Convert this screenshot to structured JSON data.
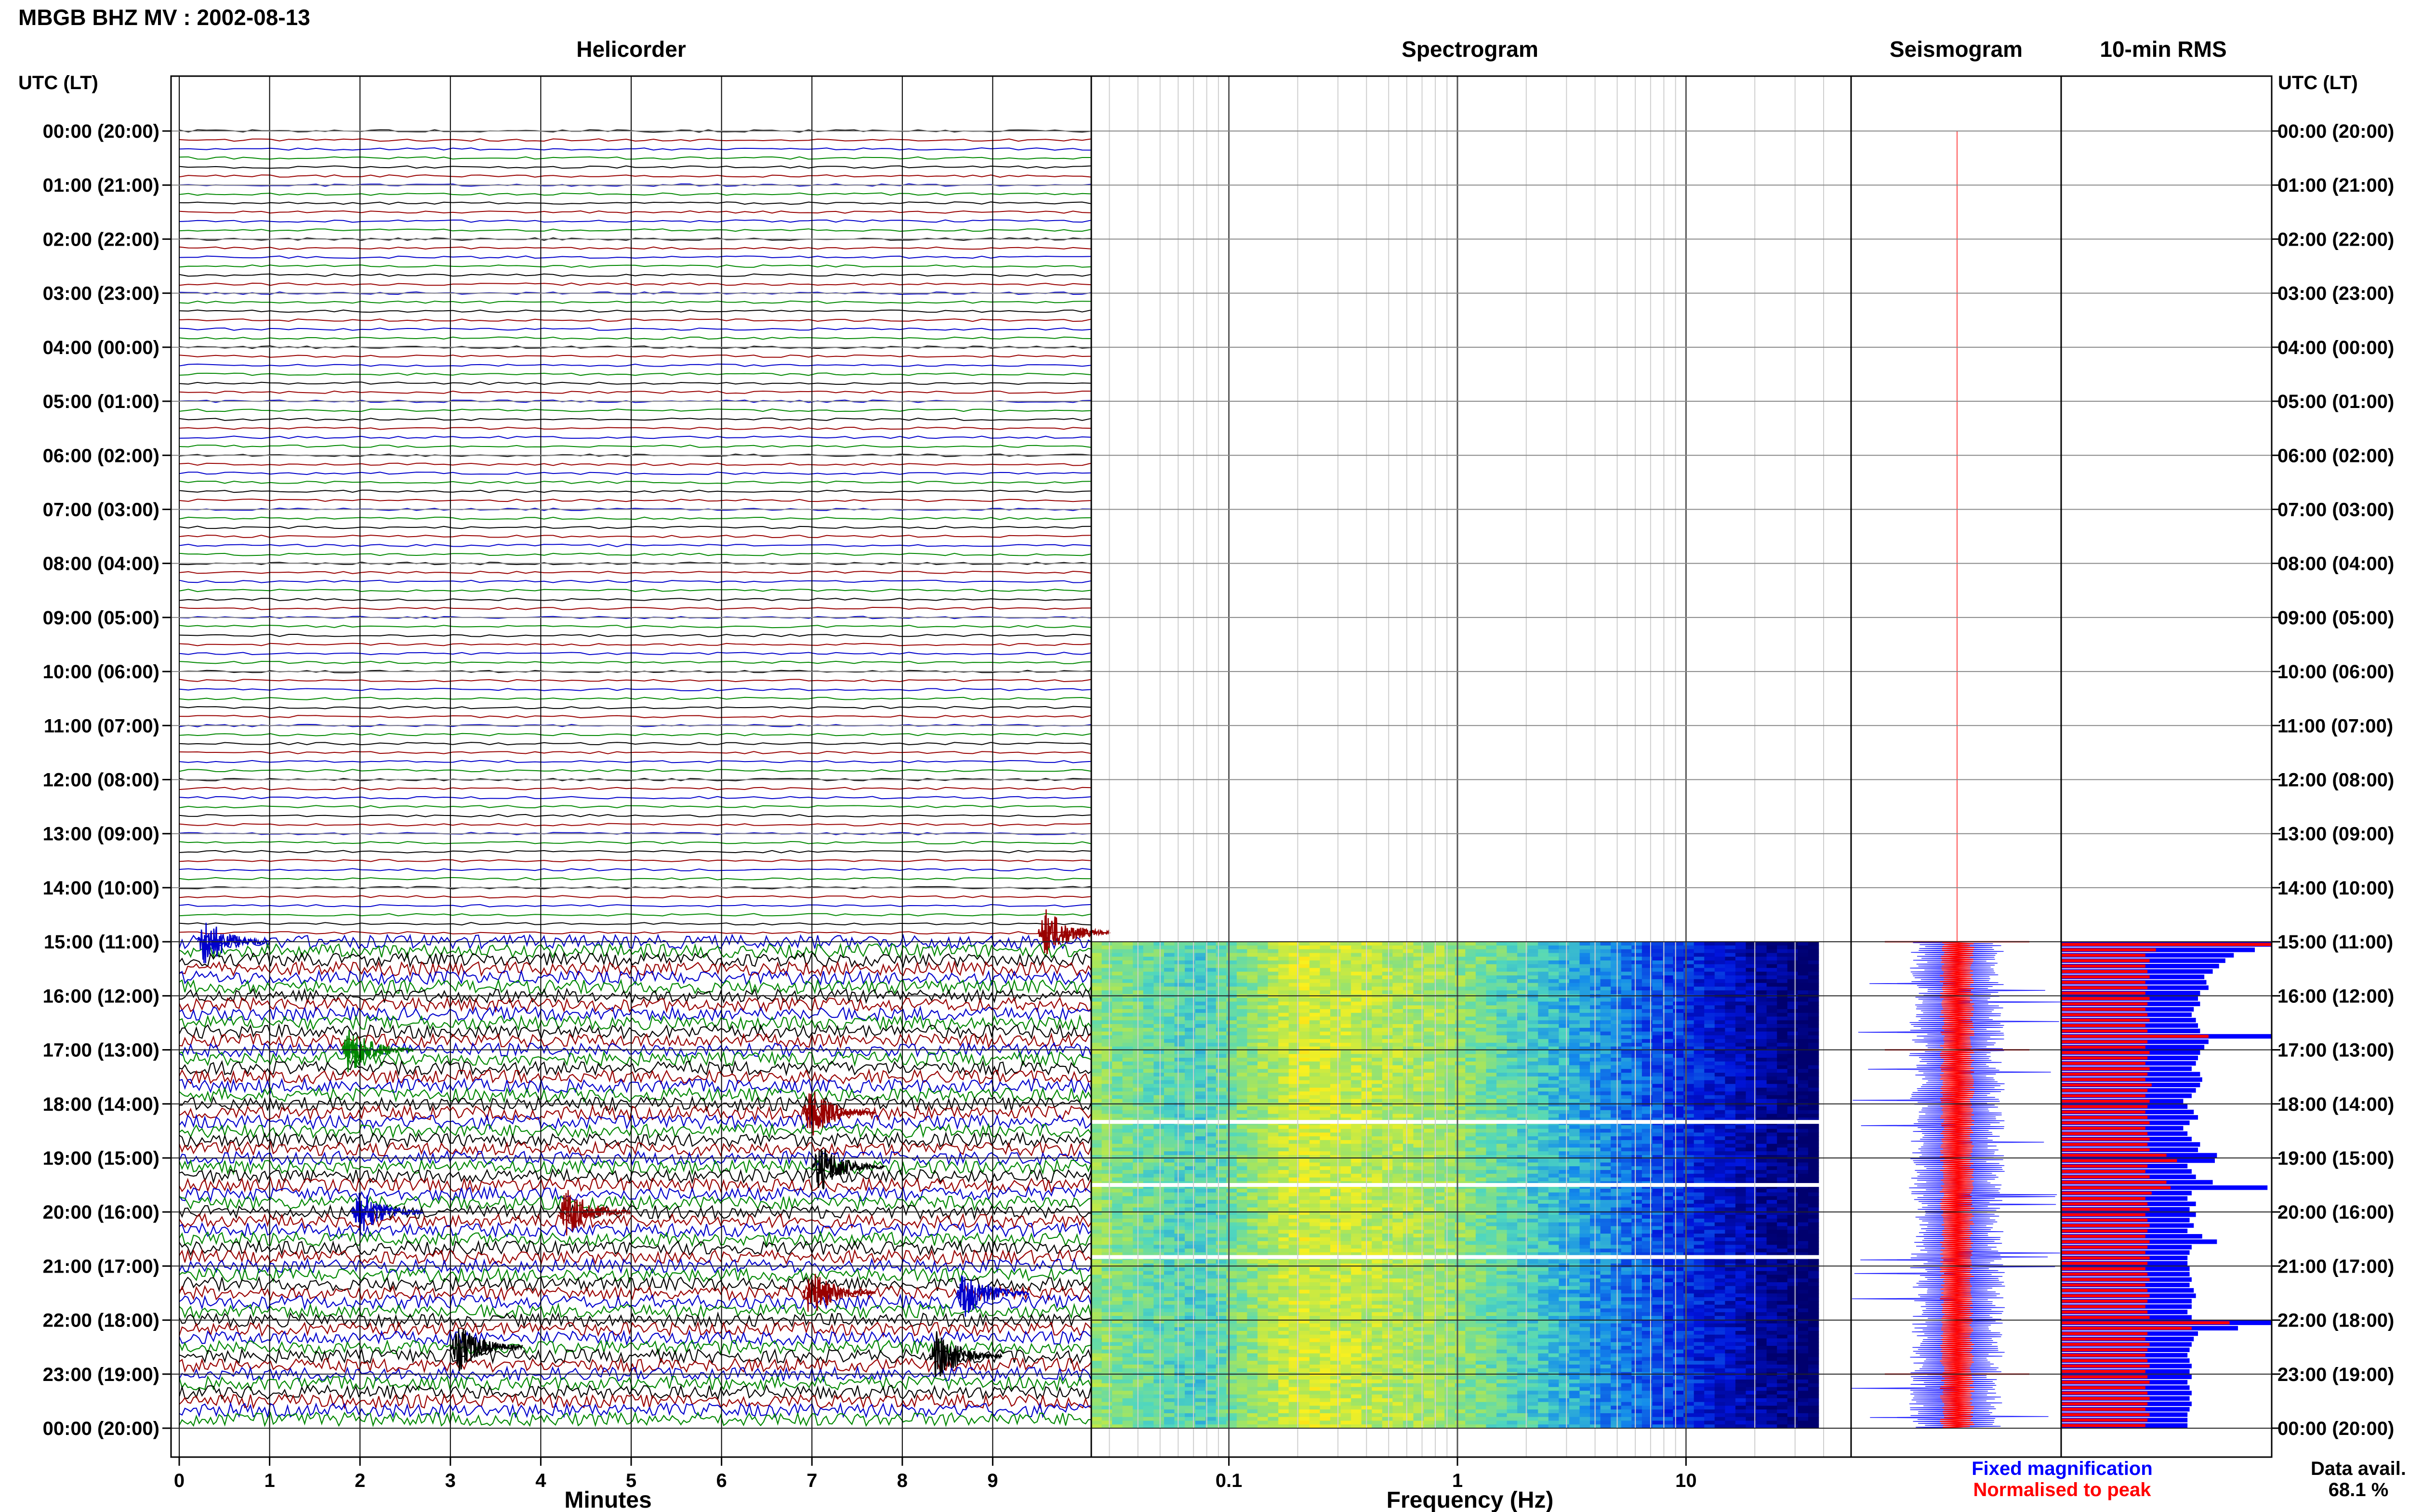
{
  "title": "MBGB BHZ MV : 2002-08-13",
  "panels": {
    "helicorder": "Helicorder",
    "spectrogram": "Spectrogram",
    "seismogram": "Seismogram",
    "rms": "10-min RMS"
  },
  "time_axis_label": "UTC (LT)",
  "time_ticks": [
    "00:00 (20:00)",
    "01:00 (21:00)",
    "02:00 (22:00)",
    "03:00 (23:00)",
    "04:00 (00:00)",
    "05:00 (01:00)",
    "06:00 (02:00)",
    "07:00 (03:00)",
    "08:00 (04:00)",
    "09:00 (05:00)",
    "10:00 (06:00)",
    "11:00 (07:00)",
    "12:00 (08:00)",
    "13:00 (09:00)",
    "14:00 (10:00)",
    "15:00 (11:00)",
    "16:00 (12:00)",
    "17:00 (13:00)",
    "18:00 (14:00)",
    "19:00 (15:00)",
    "20:00 (16:00)",
    "21:00 (17:00)",
    "22:00 (18:00)",
    "23:00 (19:00)",
    "00:00 (20:00)"
  ],
  "minutes_ticks": [
    "0",
    "1",
    "2",
    "3",
    "4",
    "5",
    "6",
    "7",
    "8",
    "9"
  ],
  "minutes_label": "Minutes",
  "freq_ticks": [
    "0.1",
    "1",
    "10"
  ],
  "freq_label": "Frequency (Hz)",
  "legend": {
    "fixed": "Fixed magnification",
    "normalised": "Normalised to peak",
    "fixed_color": "#0000ff",
    "normalised_color": "#ff0000"
  },
  "data_avail": {
    "label": "Data avail.",
    "value": "68.1 %"
  },
  "chart_data": {
    "type": "heatmap",
    "title": "MBGB BHZ MV : 2002-08-13",
    "y_ticks": [
      "00:00",
      "01:00",
      "02:00",
      "03:00",
      "04:00",
      "05:00",
      "06:00",
      "07:00",
      "08:00",
      "09:00",
      "10:00",
      "11:00",
      "12:00",
      "13:00",
      "14:00",
      "15:00",
      "16:00",
      "17:00",
      "18:00",
      "19:00",
      "20:00",
      "21:00",
      "22:00",
      "23:00",
      "00:00"
    ],
    "helicorder_xlim": [
      0,
      10
    ],
    "spectrogram_xlim_hz": [
      0.025,
      40
    ],
    "spectrogram_xscale": "log",
    "data_start_utc": "15:00",
    "trace_colors": [
      "#000000",
      "#990000",
      "#0000cc",
      "#008800"
    ],
    "events": [
      {
        "utc": "15:00",
        "minute": 0.2,
        "color": "#0000cc"
      },
      {
        "utc": "14:50",
        "minute": 9.5,
        "color": "#990000"
      },
      {
        "utc": "17:00",
        "minute": 1.8,
        "color": "#008800"
      },
      {
        "utc": "18:10",
        "minute": 6.9,
        "color": "#990000"
      },
      {
        "utc": "19:10",
        "minute": 7.0,
        "color": "#000000"
      },
      {
        "utc": "20:00",
        "minute": 1.9,
        "color": "#0000cc"
      },
      {
        "utc": "20:00",
        "minute": 4.2,
        "color": "#990000"
      },
      {
        "utc": "21:30",
        "minute": 8.6,
        "color": "#0000cc"
      },
      {
        "utc": "21:30",
        "minute": 6.9,
        "color": "#990000"
      },
      {
        "utc": "22:30",
        "minute": 3.0,
        "color": "#000000"
      },
      {
        "utc": "22:40",
        "minute": 8.3,
        "color": "#000000"
      }
    ],
    "rms": {
      "fixed_magnification_relative": [
        1.0,
        0.92,
        0.82,
        0.78,
        0.75,
        0.72,
        0.68,
        0.69,
        0.7,
        0.66,
        0.65,
        0.66,
        0.63,
        0.62,
        0.64,
        0.65,
        0.66,
        1.0,
        0.7,
        0.68,
        0.66,
        0.65,
        0.64,
        0.62,
        0.66,
        0.67,
        0.66,
        0.64,
        0.62,
        0.58,
        0.6,
        0.63,
        0.65,
        0.61,
        0.58,
        0.6,
        0.62,
        0.66,
        0.65,
        0.74,
        0.73,
        0.6,
        0.62,
        0.64,
        0.72,
        0.98,
        0.62,
        0.6,
        0.64,
        0.61,
        0.64,
        0.61,
        0.63,
        0.6,
        0.67,
        0.74,
        0.62,
        0.61,
        0.6,
        0.6,
        0.61,
        0.61,
        0.62,
        0.61,
        0.63,
        0.64,
        0.62,
        0.62,
        0.6,
        0.62,
        1.0,
        0.84,
        0.65,
        0.63,
        0.62,
        0.61,
        0.6,
        0.61,
        0.62,
        0.61,
        0.62,
        0.6,
        0.61,
        0.62,
        0.61,
        0.62,
        0.61,
        0.6,
        0.6,
        0.6
      ],
      "normalised_relative": [
        1.0,
        0.45,
        0.4,
        0.42,
        0.4,
        0.41,
        0.42,
        0.4,
        0.41,
        0.4,
        0.42,
        0.41,
        0.4,
        0.41,
        0.42,
        0.4,
        0.41,
        0.7,
        0.41,
        0.4,
        0.42,
        0.41,
        0.4,
        0.42,
        0.41,
        0.4,
        0.43,
        0.41,
        0.4,
        0.42,
        0.41,
        0.4,
        0.41,
        0.42,
        0.4,
        0.41,
        0.42,
        0.41,
        0.42,
        0.5,
        0.55,
        0.41,
        0.4,
        0.42,
        0.5,
        0.52,
        0.43,
        0.4,
        0.41,
        0.42,
        0.4,
        0.41,
        0.42,
        0.41,
        0.4,
        0.42,
        0.41,
        0.4,
        0.42,
        0.41,
        0.4,
        0.41,
        0.42,
        0.4,
        0.41,
        0.42,
        0.41,
        0.4,
        0.41,
        0.42,
        0.8,
        0.62,
        0.41,
        0.4,
        0.42,
        0.41,
        0.4,
        0.41,
        0.42,
        0.4,
        0.41,
        0.42,
        0.4,
        0.41,
        0.42,
        0.41,
        0.4,
        0.42,
        0.41,
        0.4
      ]
    }
  }
}
